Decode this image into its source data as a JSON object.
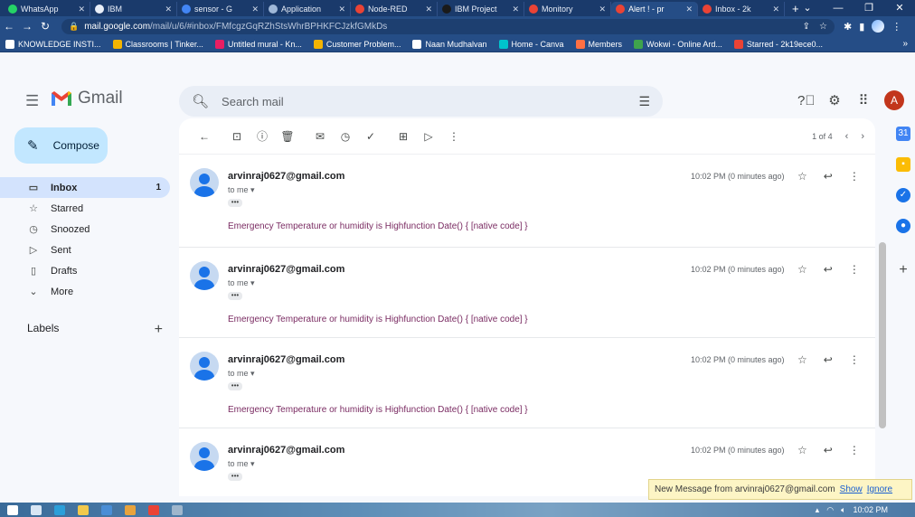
{
  "browser": {
    "tabs": [
      {
        "label": "WhatsApp",
        "color": "#25d366",
        "active": false
      },
      {
        "label": "IBM",
        "color": "#e8eef8",
        "active": false
      },
      {
        "label": "sensor - G",
        "color": "#4285f4",
        "active": false
      },
      {
        "label": "Application",
        "color": "#9fb8d8",
        "active": false
      },
      {
        "label": "Node-RED",
        "color": "#ea4335",
        "active": false
      },
      {
        "label": "IBM Project",
        "color": "#1a1a1a",
        "active": false
      },
      {
        "label": "Monitory",
        "color": "#ea4335",
        "active": false
      },
      {
        "label": "Alert ! - pr",
        "color": "#ea4335",
        "active": true
      },
      {
        "label": "Inbox - 2k",
        "color": "#ea4335",
        "active": false
      }
    ],
    "new_tab": "+",
    "url_host": "mail.google.com",
    "url_path": "/mail/u/6/#inbox/FMfcgzGqRZhStsWhrBPHKFCJzkfGMkDs",
    "bookmarks": [
      {
        "label": "KNOWLEDGE INSTI...",
        "color": "#ffffff"
      },
      {
        "label": "Classrooms | Tinker...",
        "color": "#f4b400"
      },
      {
        "label": "Untitled mural - Kn...",
        "color": "#e91e63"
      },
      {
        "label": "Customer Problem...",
        "color": "#f4b400"
      },
      {
        "label": "Naan Mudhalvan",
        "color": "#ffffff"
      },
      {
        "label": "Home - Canva",
        "color": "#00c4cc"
      },
      {
        "label": "Members",
        "color": "#ff7043"
      },
      {
        "label": "Wokwi - Online Ard...",
        "color": "#3fa34d"
      },
      {
        "label": "Starred - 2k19ece0...",
        "color": "#ea4335"
      }
    ],
    "bookmarks_more": "»"
  },
  "gmail": {
    "logo_text": "Gmail",
    "search_placeholder": "Search mail",
    "avatar_letter": "A",
    "compose_label": "Compose",
    "nav": [
      {
        "label": "Inbox",
        "icon": "inbox-icon",
        "glyph": "▭",
        "count": "1",
        "active": true
      },
      {
        "label": "Starred",
        "icon": "star-icon",
        "glyph": "☆",
        "count": "",
        "active": false
      },
      {
        "label": "Snoozed",
        "icon": "clock-icon",
        "glyph": "◷",
        "count": "",
        "active": false
      },
      {
        "label": "Sent",
        "icon": "send-icon",
        "glyph": "▷",
        "count": "",
        "active": false
      },
      {
        "label": "Drafts",
        "icon": "draft-icon",
        "glyph": "▯",
        "count": "",
        "active": false
      },
      {
        "label": "More",
        "icon": "chevron-down-icon",
        "glyph": "⌄",
        "count": "",
        "active": false
      }
    ],
    "labels_heading": "Labels",
    "pager_text": "1 of 4",
    "messages": [
      {
        "from": "arvinraj0627@gmail.com",
        "to": "to me ▾",
        "time": "10:02 PM (0 minutes ago)",
        "body": "Emergency Temperature or humidity is Highfunction Date() { [native code] }"
      },
      {
        "from": "arvinraj0627@gmail.com",
        "to": "to me ▾",
        "time": "10:02 PM (0 minutes ago)",
        "body": "Emergency Temperature or humidity is Highfunction Date() { [native code] }"
      },
      {
        "from": "arvinraj0627@gmail.com",
        "to": "to me ▾",
        "time": "10:02 PM (0 minutes ago)",
        "body": "Emergency Temperature or humidity is Highfunction Date() { [native code] }"
      },
      {
        "from": "arvinraj0627@gmail.com",
        "to": "to me ▾",
        "time": "10:02 PM (0 minutes ago)",
        "body": ""
      }
    ]
  },
  "notification": {
    "text": "New Message from arvinraj0627@gmail.com",
    "show": "Show",
    "ignore": "Ignore"
  },
  "taskbar": {
    "clock": "10:02 PM"
  }
}
